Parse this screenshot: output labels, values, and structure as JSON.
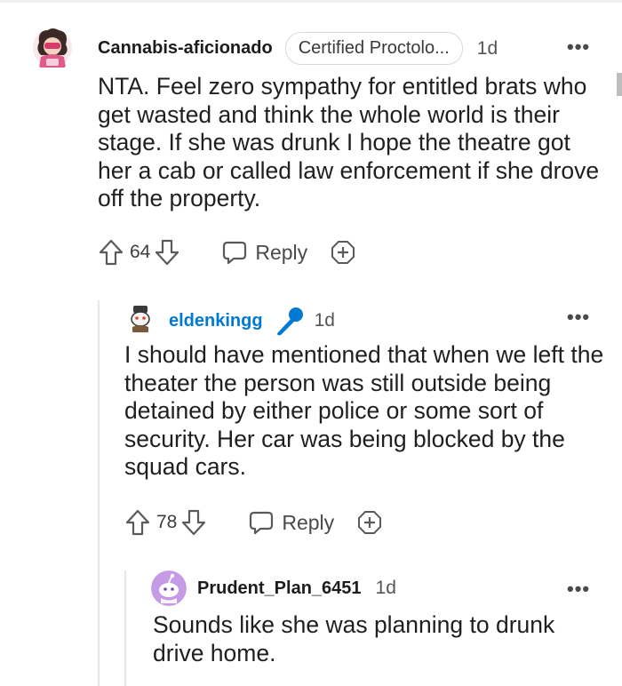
{
  "comments": [
    {
      "username": "Cannabis-aficionado",
      "flair": "Certified Proctolo...",
      "age": "1d",
      "more": "•••",
      "body": "NTA. Feel zero sympathy for entitled brats who get wasted and think the whole world is their stage. If she was drunk I hope the theatre got her a cab or called law enforcement if she drove off the property.",
      "score": "64",
      "reply_label": "Reply"
    },
    {
      "username": "eldenkingg",
      "age": "1d",
      "more": "•••",
      "body": "I should have mentioned that when we left the theater the person was still outside being detained by either police or some sort of security. Her car was being blocked by the squad cars.",
      "score": "78",
      "reply_label": "Reply"
    },
    {
      "username": "Prudent_Plan_6451",
      "age": "1d",
      "more": "•••",
      "body": "Sounds like she was planning to drunk drive home."
    }
  ],
  "colors": {
    "op_accent": "#0079d3",
    "thread_line": "#e4e6e8",
    "avatar_purple": "#c59be6"
  },
  "icons": [
    "upvote-icon",
    "downvote-icon",
    "reply-icon",
    "award-icon",
    "microphone-icon"
  ]
}
